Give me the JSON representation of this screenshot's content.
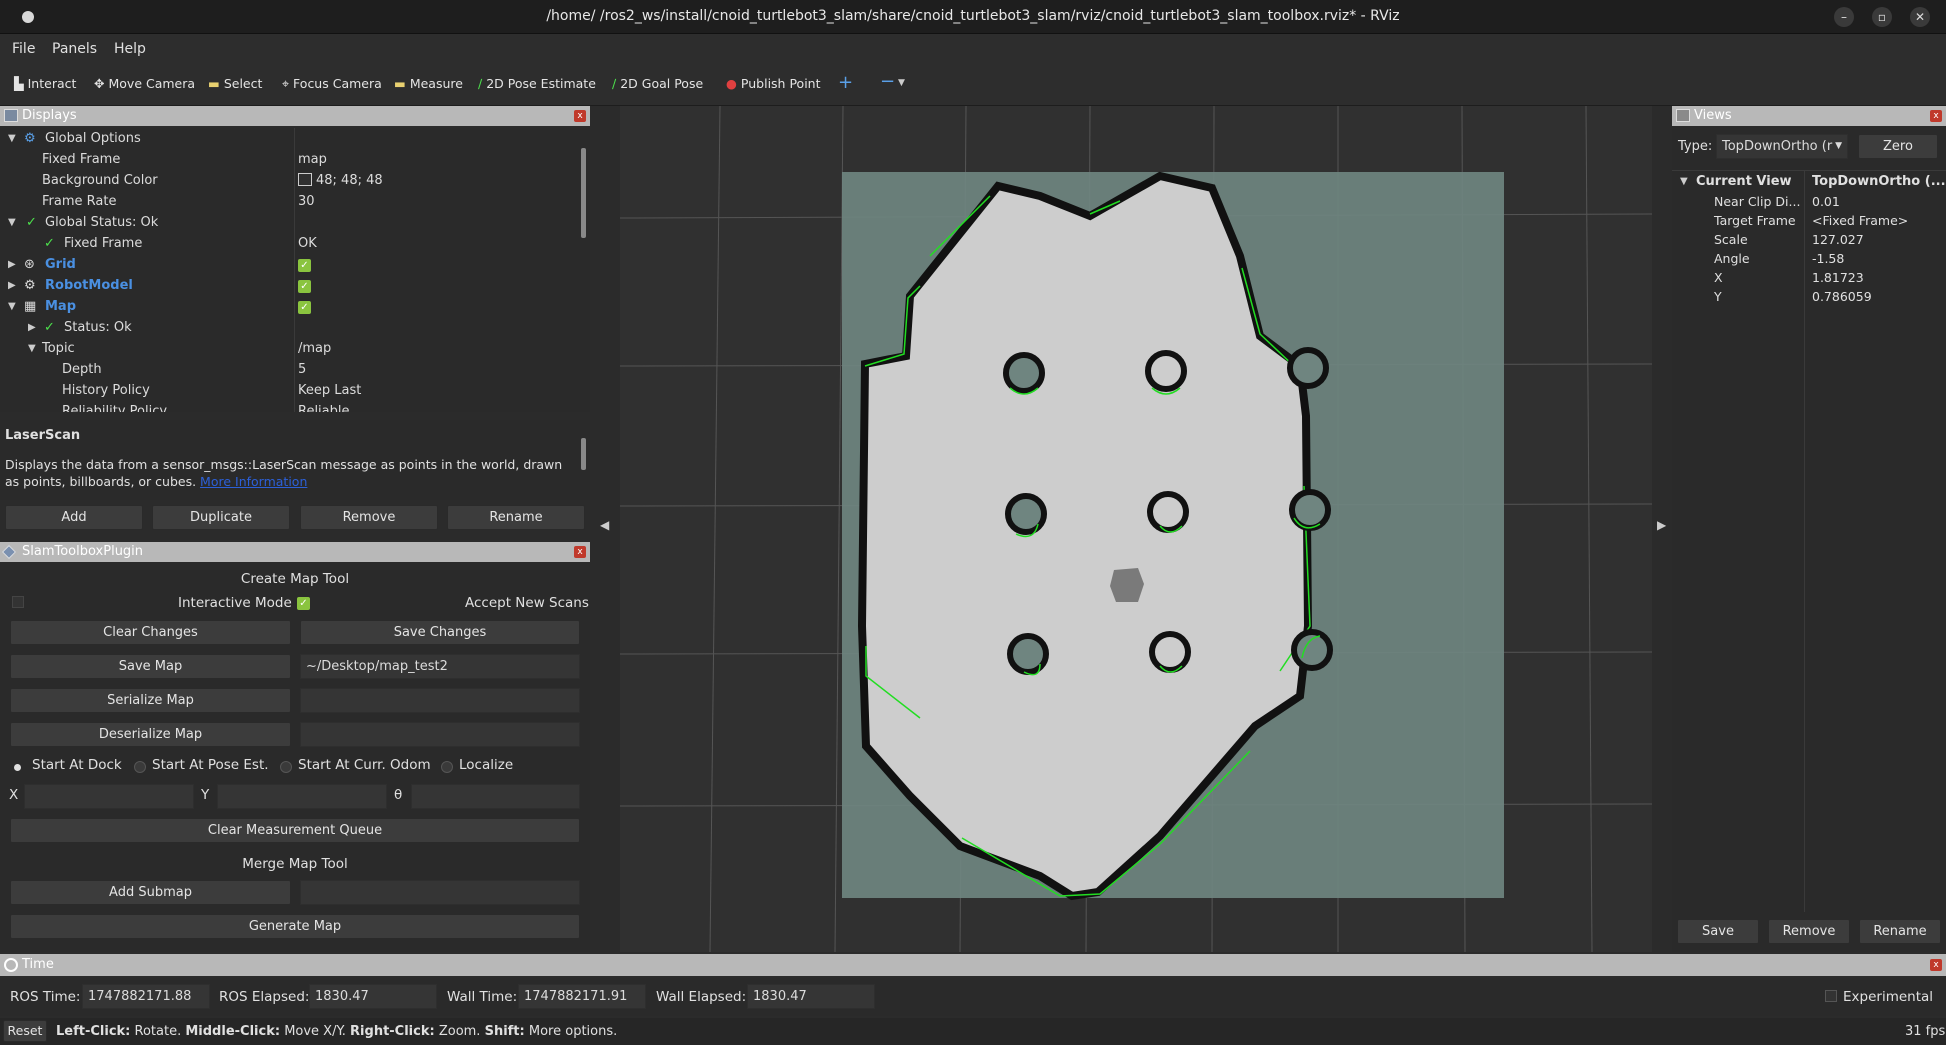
{
  "window": {
    "title": "/home/       /ros2_ws/install/cnoid_turtlebot3_slam/share/cnoid_turtlebot3_slam/rviz/cnoid_turtlebot3_slam_toolbox.rviz* - RViz"
  },
  "menu": [
    "File",
    "Panels",
    "Help"
  ],
  "toolbar": {
    "interact": "Interact",
    "move_camera": "Move Camera",
    "select": "Select",
    "focus_camera": "Focus Camera",
    "measure": "Measure",
    "pose_estimate": "2D Pose Estimate",
    "goal_pose": "2D Goal Pose",
    "publish_point": "Publish Point",
    "plus": "+",
    "minus": "−"
  },
  "displays": {
    "title": "Displays",
    "rows": [
      {
        "label": "Global Options",
        "value": ""
      },
      {
        "label": "Fixed Frame",
        "value": "map"
      },
      {
        "label": "Background Color",
        "value": "48; 48; 48"
      },
      {
        "label": "Frame Rate",
        "value": "30"
      },
      {
        "label": "Global Status: Ok",
        "value": ""
      },
      {
        "label": "Fixed Frame",
        "value": "OK"
      },
      {
        "label": "Grid",
        "value": ""
      },
      {
        "label": "RobotModel",
        "value": ""
      },
      {
        "label": "Map",
        "value": ""
      },
      {
        "label": "Status: Ok",
        "value": ""
      },
      {
        "label": "Topic",
        "value": "/map"
      },
      {
        "label": "Depth",
        "value": "5"
      },
      {
        "label": "History Policy",
        "value": "Keep Last"
      },
      {
        "label": "Reliability Policy",
        "value": "Reliable"
      }
    ],
    "desc_title": "LaserScan",
    "desc_text": "Displays the data from a sensor_msgs::LaserScan message as points in the world, drawn as points, billboards, or cubes.",
    "desc_link": "More Information",
    "buttons": [
      "Add",
      "Duplicate",
      "Remove",
      "Rename"
    ]
  },
  "slam": {
    "title": "SlamToolboxPlugin",
    "create_map_tool": "Create Map Tool",
    "interactive_mode": "Interactive Mode",
    "accept_new_scans": "Accept New Scans",
    "clear_changes": "Clear Changes",
    "save_changes": "Save Changes",
    "save_map": "Save Map",
    "save_map_path": "~/Desktop/map_test2",
    "serialize_map": "Serialize Map",
    "deserialize_map": "Deserialize Map",
    "radios": [
      "Start At Dock",
      "Start At Pose Est.",
      "Start At Curr. Odom",
      "Localize"
    ],
    "x_label": "X",
    "y_label": "Y",
    "theta_label": "θ",
    "clear_measurement_queue": "Clear Measurement Queue",
    "merge_map_tool": "Merge Map Tool",
    "add_submap": "Add Submap",
    "generate_map": "Generate Map"
  },
  "views": {
    "title": "Views",
    "type_label": "Type:",
    "type_value": "TopDownOrtho (r",
    "zero": "Zero",
    "current_view": "Current View",
    "current_view_value": "TopDownOrtho (...",
    "props": [
      {
        "k": "Near Clip Di...",
        "v": "0.01"
      },
      {
        "k": "Target Frame",
        "v": "<Fixed Frame>"
      },
      {
        "k": "Scale",
        "v": "127.027"
      },
      {
        "k": "Angle",
        "v": "-1.58"
      },
      {
        "k": "X",
        "v": "1.81723"
      },
      {
        "k": "Y",
        "v": "0.786059"
      }
    ],
    "buttons": [
      "Save",
      "Remove",
      "Rename"
    ]
  },
  "time": {
    "title": "Time",
    "ros_time_label": "ROS Time:",
    "ros_time": "1747882171.88",
    "ros_elapsed_label": "ROS Elapsed:",
    "ros_elapsed": "1830.47",
    "wall_time_label": "Wall Time:",
    "wall_time": "1747882171.91",
    "wall_elapsed_label": "Wall Elapsed:",
    "wall_elapsed": "1830.47",
    "experimental": "Experimental"
  },
  "status": {
    "reset": "Reset",
    "left_click": "Left-Click:",
    "left_click_desc": "Rotate.",
    "middle_click": "Middle-Click:",
    "middle_click_desc": "Move X/Y.",
    "right_click": "Right-Click:",
    "right_click_desc": "Zoom.",
    "shift": "Shift:",
    "shift_desc": "More options.",
    "fps": "31 fps"
  },
  "colors": {
    "background": "#303030",
    "map_free": "#cdcdcd",
    "map_unknown": "#6f8580",
    "map_wall": "#111111",
    "laser": "#22dd22",
    "check": "#8ac43f",
    "link": "#4a90e2"
  }
}
